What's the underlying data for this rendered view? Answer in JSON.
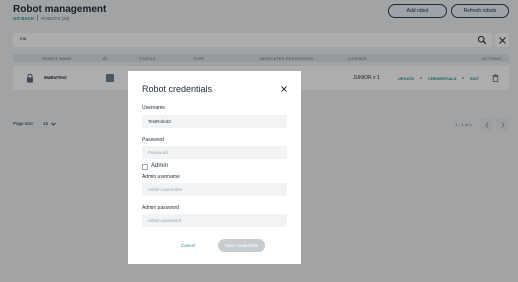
{
  "header": {
    "title": "Robot management",
    "back_label": "GO BACK",
    "breadcrumb_label": "ROBOTS (23)",
    "add_button": "Add robot",
    "refresh_button": "Refresh robots"
  },
  "search": {
    "value": "ma",
    "icon": "search-icon",
    "clear_icon": "close-icon"
  },
  "table": {
    "columns": [
      "ROBOT NAME",
      "ID",
      "STATUS",
      "TYPE",
      "DEDICATED RESOURCES",
      "LICENCE",
      "ACTIONS"
    ],
    "rows": [
      {
        "icon": "lock-icon",
        "name": "MaBotTest",
        "licence": "JUNIOR x 1",
        "actions": [
          "UPDATE",
          "CREDENTIALS",
          "EDIT"
        ],
        "delete_icon": "trash-icon"
      }
    ]
  },
  "pagination": {
    "page_size_label": "Page size:",
    "page_size": "15",
    "info": "1 – 1 of 1"
  },
  "modal": {
    "title": "Robot credentials",
    "username_label": "Username",
    "username_value": "TestRobot3",
    "password_label": "Password",
    "password_placeholder": "Password",
    "admin_label": "Admin",
    "admin_checked": false,
    "admin_username_label": "Admin username",
    "admin_username_placeholder": "Admin username",
    "admin_password_label": "Admin password",
    "admin_password_placeholder": "Admin password",
    "cancel": "Cancel",
    "save": "Save credentials"
  },
  "colors": {
    "accent": "#2a8f96",
    "disabled": "#c7ccd1",
    "dark": "#1f2d3a"
  }
}
